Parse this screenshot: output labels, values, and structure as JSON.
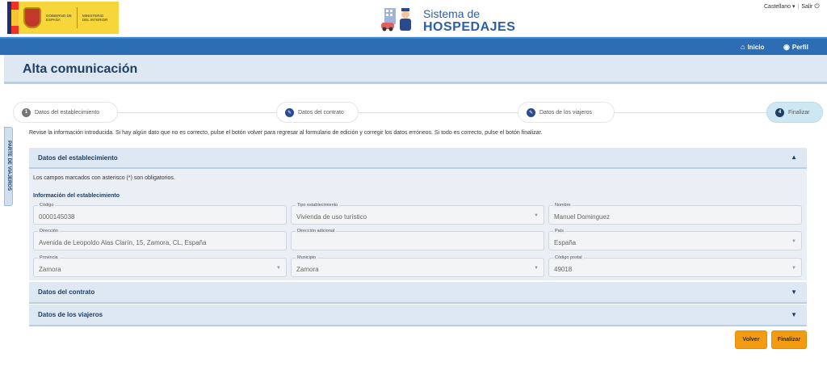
{
  "gov": {
    "line1": "GOBIERNO DE ESPAÑA",
    "line2": "MINISTERIO DEL INTERIOR"
  },
  "app": {
    "title_line1": "Sistema de",
    "title_line2": "HOSPEDAJES"
  },
  "lang": {
    "selected": "Castellano",
    "logout": "Salir"
  },
  "nav": {
    "home": "Inicio",
    "profile": "Perfil"
  },
  "page": {
    "title": "Alta comunicación",
    "side_tab": "PARTE DE VIAJEROS"
  },
  "steps": [
    {
      "num": "1",
      "label": "Datos del establecimiento"
    },
    {
      "label": "Datos del contrato"
    },
    {
      "label": "Datos de los viajeros"
    },
    {
      "num": "4",
      "label": "Finalizar"
    }
  ],
  "info_text": "Revise la información introducida. Si hay algún dato que no es correcto, pulse el botón volver para regresar al formulario de edición y corregir los datos erróneos. Si todo es correcto, pulse el botón finalizar.",
  "sections": {
    "establecimiento": {
      "title": "Datos del establecimiento",
      "required_note": "Los campos marcados con asterisco (*) son obligatorios.",
      "subtitle": "Información del establecimiento",
      "fields": {
        "codigo": {
          "label": "Código",
          "value": "0000145038"
        },
        "tipo": {
          "label": "Tipo establecimiento",
          "value": "Vivienda de uso turístico"
        },
        "nombre": {
          "label": "Nombre",
          "value": "Manuel Dominguez"
        },
        "direccion": {
          "label": "Dirección",
          "value": "Avenida de Leopoldo Alas Clarín, 15, Zamora, CL, España"
        },
        "direccion_adicional": {
          "label": "Dirección adicional",
          "value": ""
        },
        "pais": {
          "label": "País",
          "value": "España"
        },
        "provincia": {
          "label": "Provincia",
          "value": "Zamora"
        },
        "municipio": {
          "label": "Municipio",
          "value": "Zamora"
        },
        "cp": {
          "label": "Código postal",
          "value": "49018"
        }
      }
    },
    "contrato": {
      "title": "Datos del contrato"
    },
    "viajeros": {
      "title": "Datos de los viajeros"
    }
  },
  "buttons": {
    "back": "Volver",
    "finish": "Finalizar"
  },
  "colors": {
    "navbar": "#2d6db3",
    "title": "#1f3e64",
    "accent": "#f39c12",
    "panel": "#dde8f3"
  }
}
